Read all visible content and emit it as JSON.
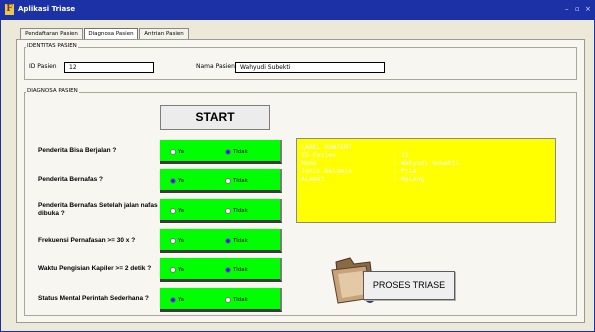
{
  "window": {
    "logo_letter": "F",
    "title": "Aplikasi Triase",
    "controls": [
      "–",
      "▫",
      "×"
    ]
  },
  "tabs": [
    {
      "label": "Pendaftaran Pasien",
      "active": false
    },
    {
      "label": "Diagnosa Pasien",
      "active": true
    },
    {
      "label": "Antrian Pasien",
      "active": false
    }
  ],
  "identitas": {
    "legend": "IDENTITAS PASIEN",
    "id_label": "ID Pasien",
    "id_value": "12",
    "nama_label": "Nama Pasien",
    "nama_value": "Wahyudi Subekti"
  },
  "diagnosa": {
    "legend": "DIAGNOSA PASIEN",
    "start_label": "START",
    "questions": [
      {
        "label": "Penderita Bisa Berjalan ?",
        "ya": "Ya",
        "tidak": "Tidak",
        "selected": "tidak"
      },
      {
        "label": "Penderita Bernafas ?",
        "ya": "Ya",
        "tidak": "Tidak",
        "selected": "ya"
      },
      {
        "label": "Penderita Bernafas Setelah jalan nafas dibuka ?",
        "ya": "Ya",
        "tidak": "Tidak",
        "selected": null
      },
      {
        "label": "Frekuensi Pernafasan >= 30 x ?",
        "ya": "Ya",
        "tidak": "Tidak",
        "selected": "tidak"
      },
      {
        "label": "Waktu Pengisian Kapiler >= 2 detik ?",
        "ya": "Ya",
        "tidak": "Tidak",
        "selected": "tidak"
      },
      {
        "label": "Status Mental Perintah Sederhana ?",
        "ya": "Ya",
        "tidak": "Tidak",
        "selected": "ya"
      }
    ],
    "info": {
      "title": "LABEL KONTENT",
      "rows": [
        {
          "key": "ID Pasien",
          "value": ": 12"
        },
        {
          "key": "Nama",
          "value": ": Wahyudi Subekti"
        },
        {
          "key": "Jenis Kelamin",
          "value": ": Pria"
        },
        {
          "key": "Alamat",
          "value": ": Malang"
        }
      ]
    },
    "proses_label": "PROSES TRIASE"
  },
  "colors": {
    "titlebar": "#1d31a6",
    "option_bg": "#00ff00",
    "info_bg": "#ffff00",
    "radio_checked": "#1a2fd0"
  },
  "icons": {
    "folder": "folder-icon"
  }
}
